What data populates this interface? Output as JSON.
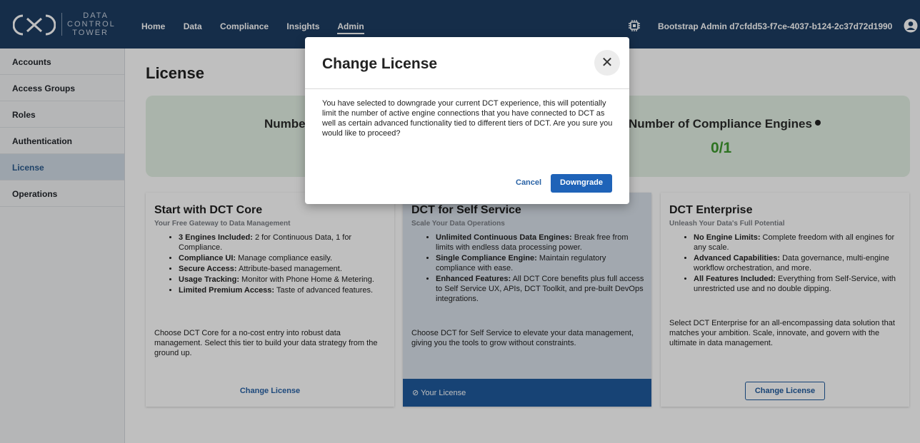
{
  "brand": {
    "logo_lines": [
      "DATA",
      "CONTROL",
      "TOWER"
    ]
  },
  "nav": {
    "items": [
      "Home",
      "Data",
      "Compliance",
      "Insights",
      "Admin"
    ],
    "active": "Admin"
  },
  "user": {
    "label": "Bootstrap Admin d7cfdd53-f7ce-4037-b124-2c37d72d1990"
  },
  "sidebar": {
    "items": [
      "Accounts",
      "Access Groups",
      "Roles",
      "Authentication",
      "License",
      "Operations"
    ],
    "active": "License"
  },
  "page": {
    "title": "License"
  },
  "stats": {
    "left_label": "Number",
    "right_label": "Number of Compliance Engines",
    "right_value": "0/1"
  },
  "cards": [
    {
      "title": "Start with DCT Core",
      "subtitle": "Your Free Gateway to Data Management",
      "bullets": [
        {
          "bold": "3 Engines Included:",
          "text": " 2 for Continuous Data, 1 for Compliance."
        },
        {
          "bold": "Compliance UI:",
          "text": " Manage compliance easily."
        },
        {
          "bold": "Secure Access:",
          "text": " Attribute-based management."
        },
        {
          "bold": "Usage Tracking:",
          "text": " Monitor with Phone Home & Metering."
        },
        {
          "bold": "Limited Premium Access:",
          "text": " Taste of advanced features."
        }
      ],
      "description": "Choose DCT Core for a no-cost entry into robust data management. Select this tier to build your data strategy from the ground up.",
      "action": "Change License"
    },
    {
      "title": "DCT for Self Service",
      "subtitle": "Scale Your Data Operations",
      "bullets": [
        {
          "bold": "Unlimited Continuous Data Engines:",
          "text": " Break free from limits with endless data processing power."
        },
        {
          "bold": "Single Compliance Engine:",
          "text": " Maintain regulatory compliance with ease."
        },
        {
          "bold": "Enhanced Features:",
          "text": " All DCT Core benefits plus full access to Self Service UX, APIs, DCT Toolkit, and pre-built DevOps integrations."
        }
      ],
      "description": "Choose DCT for Self Service to elevate your data management, giving you the tools to grow without constraints.",
      "action": "Your License"
    },
    {
      "title": "DCT Enterprise",
      "subtitle": "Unleash Your Data's Full Potential",
      "bullets": [
        {
          "bold": "No Engine Limits:",
          "text": " Complete freedom with all engines for any scale."
        },
        {
          "bold": "Advanced Capabilities:",
          "text": " Data governance, multi-engine workflow orchestration, and more."
        },
        {
          "bold": "All Features Included:",
          "text": " Everything from Self-Service, with unrestricted use and no double dipping."
        }
      ],
      "description": "Select DCT Enterprise for an all-encompassing data solution that matches your ambition. Scale, innovate, and govern with the ultimate in data management.",
      "action": "Change License"
    }
  ],
  "modal": {
    "title": "Change License",
    "body": "You have selected to downgrade your current DCT experience, this will potentially limit the number of active engine connections that you have connected to DCT as well as certain advanced functionality tied to different tiers of DCT. Are you sure you would like to proceed?",
    "cancel_label": "Cancel",
    "confirm_label": "Downgrade"
  },
  "colors": {
    "nav_bg": "#1d3c62",
    "accent": "#1f63b8",
    "success": "#3e9a2e",
    "stats_bg": "#e3f1e4"
  }
}
